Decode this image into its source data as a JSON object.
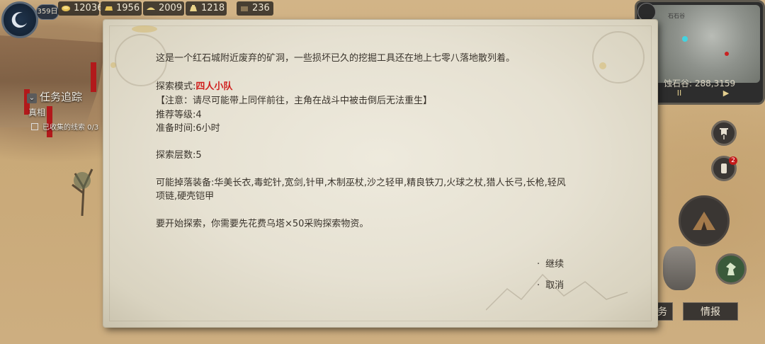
{
  "hud": {
    "day": "359日",
    "resources": [
      {
        "icon": "gold-coin-icon",
        "value": "12036"
      },
      {
        "icon": "iron-ingot-icon",
        "value": "1956"
      },
      {
        "icon": "food-icon",
        "value": "2009"
      },
      {
        "icon": "money-bag-icon",
        "value": "1218"
      },
      {
        "icon": "supply-icon",
        "value": "236"
      }
    ]
  },
  "minimap": {
    "region_label": "石石谷",
    "coords_text": "蚀石谷: 288,3159",
    "pause_label": "II",
    "play_label": "▶"
  },
  "quest": {
    "header": "任务追踪",
    "subtitle": "真相",
    "item": "已收集的线索 0/3"
  },
  "dialog": {
    "intro": "这是一个红石城附近废弃的矿洞，一些损坏已久的挖掘工具还在地上七零八落地散列着。",
    "mode_label": "探索模式:",
    "mode_value": "四人小队",
    "note": "【注意：请尽可能带上同伴前往，主角在战斗中被击倒后无法重生】",
    "level": "推荐等级:4",
    "prep_time": "准备时间:6小时",
    "floors": "探索层数:5",
    "drops_line1": "可能掉落装备:华美长衣,毒蛇针,宽剑,针甲,木制巫杖,沙之轻甲,精良铁刀,火球之杖,猎人长弓,长枪,轻风",
    "drops_line2": "项链,硬壳铠甲",
    "requirement": "要开始探索，你需要先花费乌塔×50采购探索物资。",
    "continue": "继续",
    "cancel": "取消"
  },
  "side": {
    "notify_badge": "2",
    "task_tab": "务",
    "intel_tab": "情报"
  },
  "colors": {
    "parchment": "#e6e1d2",
    "text": "#3a342c",
    "accent_red": "#d0201e",
    "hud_bg": "#28241f"
  }
}
